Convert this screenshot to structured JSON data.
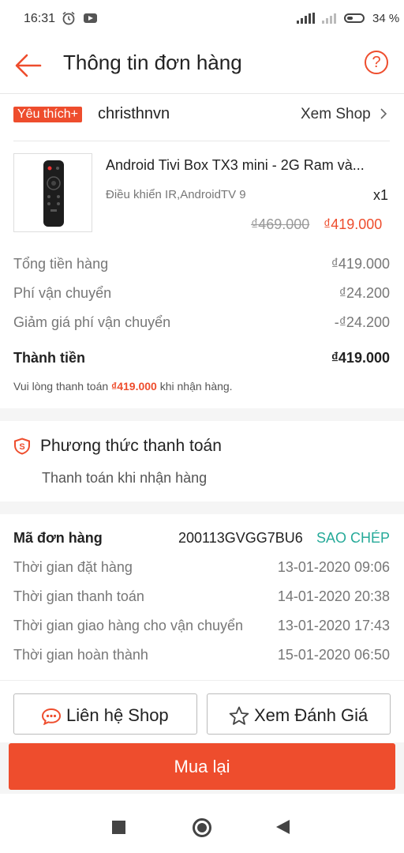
{
  "status_bar": {
    "time": "16:31",
    "battery": "34 %"
  },
  "header": {
    "title": "Thông tin đơn hàng"
  },
  "shop": {
    "badge": "Yêu thích+",
    "name": "christhnvn",
    "view_shop": "Xem Shop"
  },
  "product": {
    "name": "Android Tivi Box TX3 mini - 2G Ram và...",
    "variant": "Điều khiển IR,AndroidTV 9",
    "quantity": "x1",
    "original_price": "₫469.000",
    "price": "₫419.000"
  },
  "summary": {
    "rows": [
      {
        "label": "Tổng tiền hàng",
        "value": "₫419.000"
      },
      {
        "label": "Phí vận chuyển",
        "value": "₫24.200"
      },
      {
        "label": "Giảm giá phí vận chuyển",
        "value": "-₫24.200"
      }
    ],
    "total_label": "Thành tiền",
    "total_value": "₫419.000",
    "note_prefix": "Vui lòng thanh toán",
    "note_amount": "₫419.000",
    "note_suffix": "khi nhận hàng."
  },
  "payment": {
    "title": "Phương thức thanh toán",
    "method": "Thanh toán khi nhận hàng"
  },
  "order": {
    "code_label": "Mã đơn hàng",
    "code": "200113GVGG7BU6",
    "copy_label": "SAO CHÉP",
    "rows": [
      {
        "label": "Thời gian đặt hàng",
        "value": "13-01-2020 09:06"
      },
      {
        "label": "Thời gian thanh toán",
        "value": "14-01-2020 20:38"
      },
      {
        "label": "Thời gian giao hàng cho vận chuyển",
        "value": "13-01-2020 17:43"
      },
      {
        "label": "Thời gian hoàn thành",
        "value": "15-01-2020 06:50"
      }
    ]
  },
  "actions": {
    "contact_shop": "Liên hệ Shop",
    "view_rating": "Xem Đánh Giá",
    "buy_again": "Mua lại"
  },
  "colors": {
    "accent": "#ee4d2d",
    "copy": "#26aa99"
  },
  "icons": [
    "alarm-icon",
    "youtube-icon",
    "signal-icon",
    "battery-icon",
    "back-arrow-icon",
    "help-icon",
    "chevron-right-icon",
    "shield-icon",
    "chat-icon",
    "star-icon",
    "nav-recent-icon",
    "nav-home-icon",
    "nav-back-icon"
  ]
}
